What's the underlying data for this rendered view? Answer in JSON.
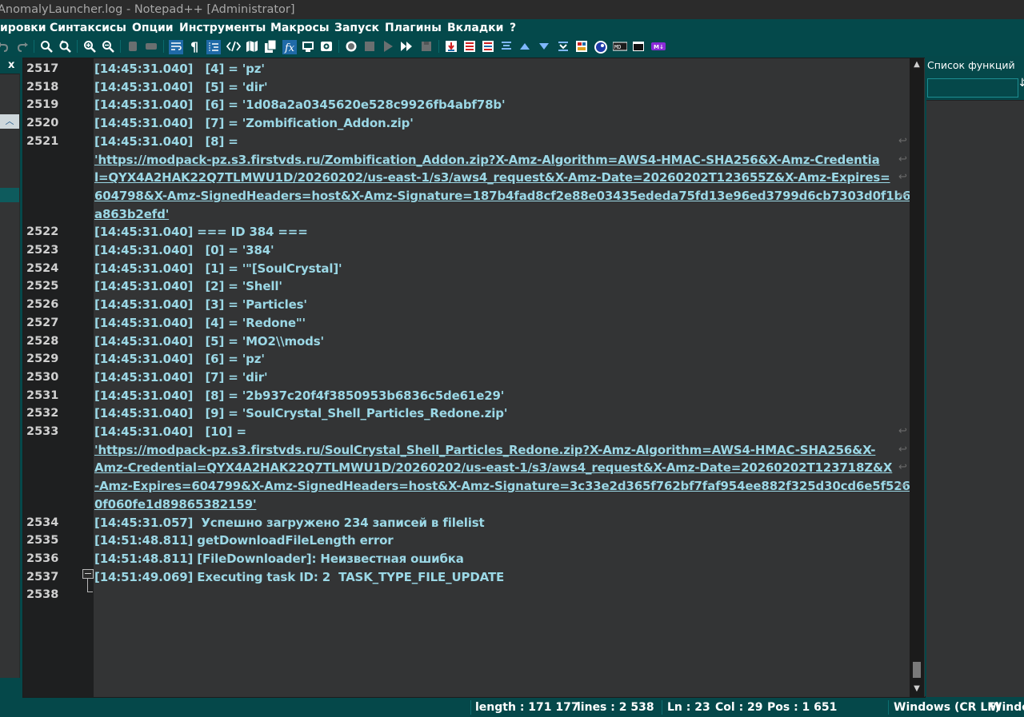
{
  "window": {
    "title": "AnomalyLauncher.log - Notepad++ [Administrator]"
  },
  "menu": [
    "ировки",
    "Синтаксисы",
    "Опции",
    "Инструменты",
    "Макросы",
    "Запуск",
    "Плагины",
    "Вкладки",
    "?"
  ],
  "toolbar_icons": [
    "undo-icon",
    "redo-icon",
    "find-icon",
    "replace-icon",
    "zoom-in-icon",
    "zoom-out-icon",
    "sync-vertical-icon",
    "sync-horizontal-icon",
    "word-wrap-icon",
    "show-all-chars-icon",
    "indent-guide-icon",
    "xml-tag-icon",
    "document-map-icon",
    "document-list-icon",
    "function-list-icon",
    "folder-workspace-icon",
    "monitoring-icon",
    "macro-record-icon",
    "macro-stop-icon",
    "macro-play-icon",
    "macro-run-multiple-icon",
    "macro-save-icon",
    "plugin-1-icon",
    "plugin-2-icon",
    "plugin-3-icon",
    "plugin-4-icon",
    "plugin-5-icon",
    "plugin-6-icon",
    "plugin-7-icon",
    "plugin-8-icon",
    "plugin-9-icon",
    "plugin-10-icon",
    "plugin-11-icon",
    "plugin-12-icon"
  ],
  "left_panel": {
    "close_label": "x"
  },
  "editor": {
    "lines": [
      {
        "num": "2517",
        "text": "[14:45:31.040]   [4] = 'pz'"
      },
      {
        "num": "2518",
        "text": "[14:45:31.040]   [5] = 'dir'"
      },
      {
        "num": "2519",
        "text": "[14:45:31.040]   [6] = '1d08a2a0345620e528c9926fb4abf78b'"
      },
      {
        "num": "2520",
        "text": "[14:45:31.040]   [7] = 'Zombification_Addon.zip'"
      },
      {
        "num": "2521",
        "text": "[14:45:31.040]   [8] ="
      },
      {
        "num": "",
        "text": "'https://modpack-pz.s3.firstvds.ru/Zombification_Addon.zip?X-Amz-Algorithm=AWS4-HMAC-SHA256&X-Amz-Credentia"
      },
      {
        "num": "",
        "text": "l=QYX4A2HAK22Q7TLMWU1D/20260202/us-east-1/s3/aws4_request&X-Amz-Date=20260202T123655Z&X-Amz-Expires="
      },
      {
        "num": "",
        "text": "604798&X-Amz-SignedHeaders=host&X-Amz-Signature=187b4fad8cf2e88e03435ededa75fd13e96ed3799d6cb7303d0f1b6"
      },
      {
        "num": "",
        "text": "a863b2efd'"
      },
      {
        "num": "2522",
        "text": "[14:45:31.040] === ID 384 ==="
      },
      {
        "num": "2523",
        "text": "[14:45:31.040]   [0] = '384'"
      },
      {
        "num": "2524",
        "text": "[14:45:31.040]   [1] = '\"[SoulCrystal]'"
      },
      {
        "num": "2525",
        "text": "[14:45:31.040]   [2] = 'Shell'"
      },
      {
        "num": "2526",
        "text": "[14:45:31.040]   [3] = 'Particles'"
      },
      {
        "num": "2527",
        "text": "[14:45:31.040]   [4] = 'Redone\"'"
      },
      {
        "num": "2528",
        "text": "[14:45:31.040]   [5] = 'MO2\\\\mods'"
      },
      {
        "num": "2529",
        "text": "[14:45:31.040]   [6] = 'pz'"
      },
      {
        "num": "2530",
        "text": "[14:45:31.040]   [7] = 'dir'"
      },
      {
        "num": "2531",
        "text": "[14:45:31.040]   [8] = '2b937c20f4f3850953b6836c5de61e29'"
      },
      {
        "num": "2532",
        "text": "[14:45:31.040]   [9] = 'SoulCrystal_Shell_Particles_Redone.zip'"
      },
      {
        "num": "2533",
        "text": "[14:45:31.040]   [10] ="
      },
      {
        "num": "",
        "text": "'https://modpack-pz.s3.firstvds.ru/SoulCrystal_Shell_Particles_Redone.zip?X-Amz-Algorithm=AWS4-HMAC-SHA256&X-"
      },
      {
        "num": "",
        "text": "Amz-Credential=QYX4A2HAK22Q7TLMWU1D/20260202/us-east-1/s3/aws4_request&X-Amz-Date=20260202T123718Z&X"
      },
      {
        "num": "",
        "text": "-Amz-Expires=604799&X-Amz-SignedHeaders=host&X-Amz-Signature=3c33e2d365f762bf7faf954ee882f325d30cd6e5f526"
      },
      {
        "num": "",
        "text": "0f060fe1d89865382159'"
      },
      {
        "num": "2534",
        "text": "[14:45:31.057]  Успешно загружено 234 записей в filelist"
      },
      {
        "num": "2535",
        "text": "[14:51:48.811] getDownloadFileLength error"
      },
      {
        "num": "2536",
        "text": "[14:51:48.811] [FileDownloader]: Неизвестная ошибка"
      },
      {
        "num": "2537",
        "text": "[14:51:49.069] Executing task ID: 2  TASK_TYPE_FILE_UPDATE"
      },
      {
        "num": "2538",
        "text": ""
      }
    ]
  },
  "function_list": {
    "title": "Список функций",
    "search_value": ""
  },
  "status": {
    "length": "length : 171 177",
    "lines": "lines : 2 538",
    "ln": "Ln : 23",
    "col": "Col : 29",
    "pos": "Pos : 1 651",
    "eol": "Windows (CR LF)",
    "encoding": "Windo"
  },
  "colors": {
    "text": "#9bd8e6",
    "background": "#333435",
    "chrome": "#05484a"
  }
}
